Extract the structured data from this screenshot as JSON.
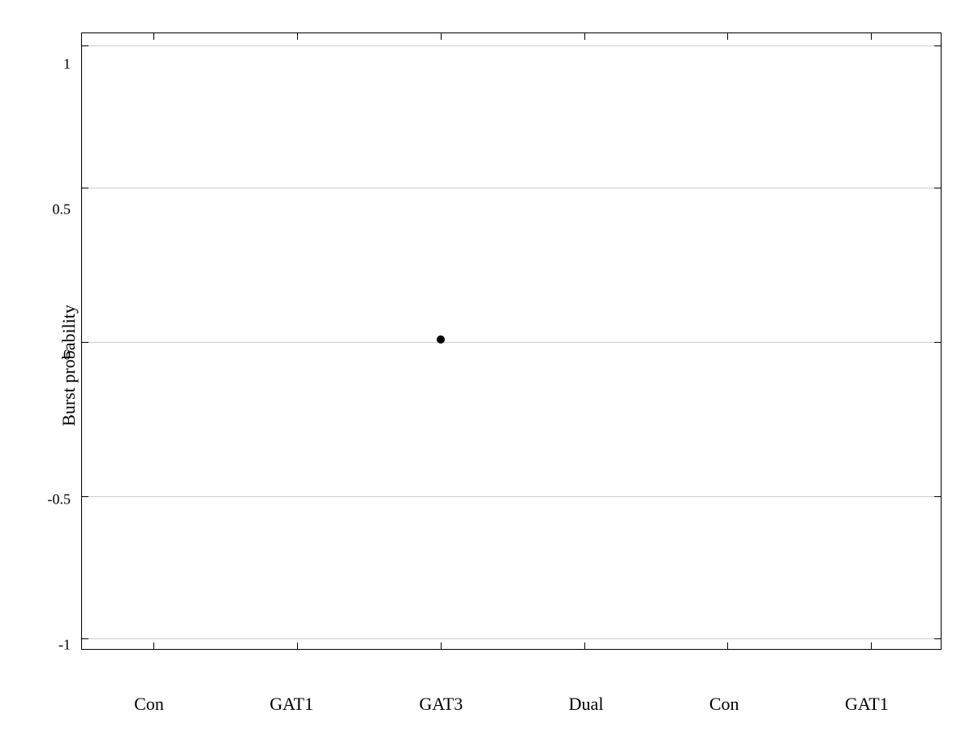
{
  "chart": {
    "title": "",
    "y_axis_label": "Burst probability",
    "x_labels": [
      "Con",
      "GAT1",
      "GAT3",
      "Dual",
      "Con",
      "GAT1"
    ],
    "y_ticks": [
      {
        "value": "1",
        "pos_pct": 2
      },
      {
        "value": "0.5",
        "pos_pct": 14.5
      },
      {
        "value": "0",
        "pos_pct": 50
      },
      {
        "value": "-0.5",
        "pos_pct": 63
      },
      {
        "value": "-1",
        "pos_pct": 97
      }
    ],
    "y_min": -1,
    "y_max": 1,
    "data_points": [
      {
        "x_label": "GAT3",
        "x_index": 2,
        "y_value": 0.01
      }
    ],
    "colors": {
      "background": "#ffffff",
      "axis": "#000000",
      "grid": "#cccccc",
      "data_point": "#000000"
    }
  }
}
